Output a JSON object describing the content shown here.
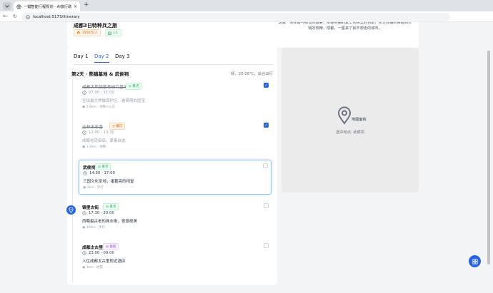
{
  "browser": {
    "tab_title": "一键智能行程规划 - AI旅行助手",
    "url": "localhost:5173/itinerary"
  },
  "trip": {
    "title": "成都3日特种兵之旅",
    "budget": "1500元/人",
    "people": "1人",
    "description": "这是一场味蕾与视觉的盛宴，从春熙路的繁华到锦里的古韵，从大熊猫的呆萌到火锅的热辣，成都，一座来了就不想走的城市。"
  },
  "days": {
    "tabs": [
      "Day 1",
      "Day 2",
      "Day 3"
    ],
    "active_index": 1,
    "title": "第2天 · 熊猫基地 & 武侯祠",
    "weather": "晴，20-28°C，适合出行"
  },
  "items": [
    {
      "name": "成都大熊猫繁育研究基地",
      "tag": "景点",
      "tag_color": "green",
      "time": "07:00 - 11:00",
      "note": "全球最大熊猫保护区，看萌萌的国宝",
      "meta": "5.6km · 地铁+公交",
      "done": true,
      "selected": false
    },
    {
      "name": "玉林串串香",
      "tag": "餐饮",
      "tag_color": "orange",
      "time": "12:00 - 13:30",
      "note": "成都地道串串，荤素自选",
      "meta": "1.2km · 地铁",
      "done": true,
      "selected": false
    },
    {
      "name": "武侯祠",
      "tag": "景点",
      "tag_color": "green",
      "time": "14:30 - 17:00",
      "note": "三国文化圣地，诸葛亮的祠堂",
      "meta": "2km · 步行",
      "done": false,
      "selected": true
    },
    {
      "name": "锦里古街",
      "tag": "景点",
      "tag_color": "green",
      "time": "17:30 - 20:00",
      "note": "西蜀最古老的商业街，夜景绝美",
      "meta": "300m · 步行",
      "done": false,
      "selected": false
    },
    {
      "name": "成都太古里",
      "tag": "住宿",
      "tag_color": "purple",
      "time": "23:00 - 09:00",
      "note": "入住成都太古里附近酒店",
      "meta": "3km · 地铁",
      "done": false,
      "selected": false
    }
  ],
  "map": {
    "title": "地图面板",
    "selected": "选中地点: 武侯祠"
  }
}
